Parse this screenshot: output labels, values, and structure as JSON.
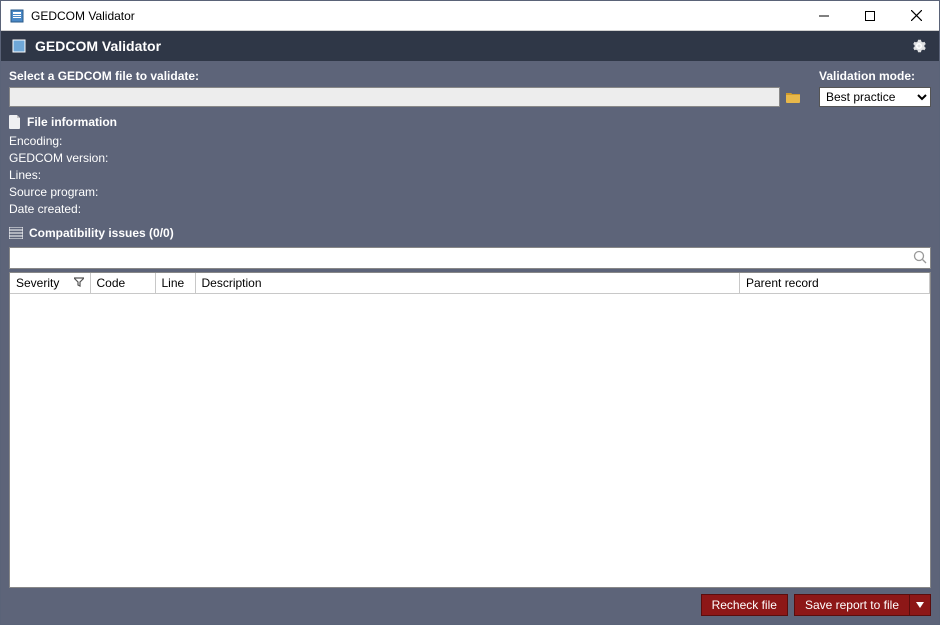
{
  "titlebar": {
    "title": "GEDCOM Validator"
  },
  "appHeader": {
    "title": "GEDCOM Validator"
  },
  "fileSelect": {
    "label": "Select a GEDCOM file to validate:",
    "value": ""
  },
  "validationMode": {
    "label": "Validation mode:",
    "selected": "Best practice"
  },
  "fileInfo": {
    "header": "File information",
    "encoding_label": "Encoding:",
    "gedcom_version_label": "GEDCOM version:",
    "lines_label": "Lines:",
    "source_program_label": "Source program:",
    "date_created_label": "Date created:"
  },
  "compat": {
    "header": "Compatibility issues (0/0)",
    "search_value": ""
  },
  "table": {
    "columns": {
      "severity": "Severity",
      "code": "Code",
      "line": "Line",
      "description": "Description",
      "parent": "Parent record"
    }
  },
  "footer": {
    "recheck": "Recheck file",
    "save": "Save report to file"
  }
}
